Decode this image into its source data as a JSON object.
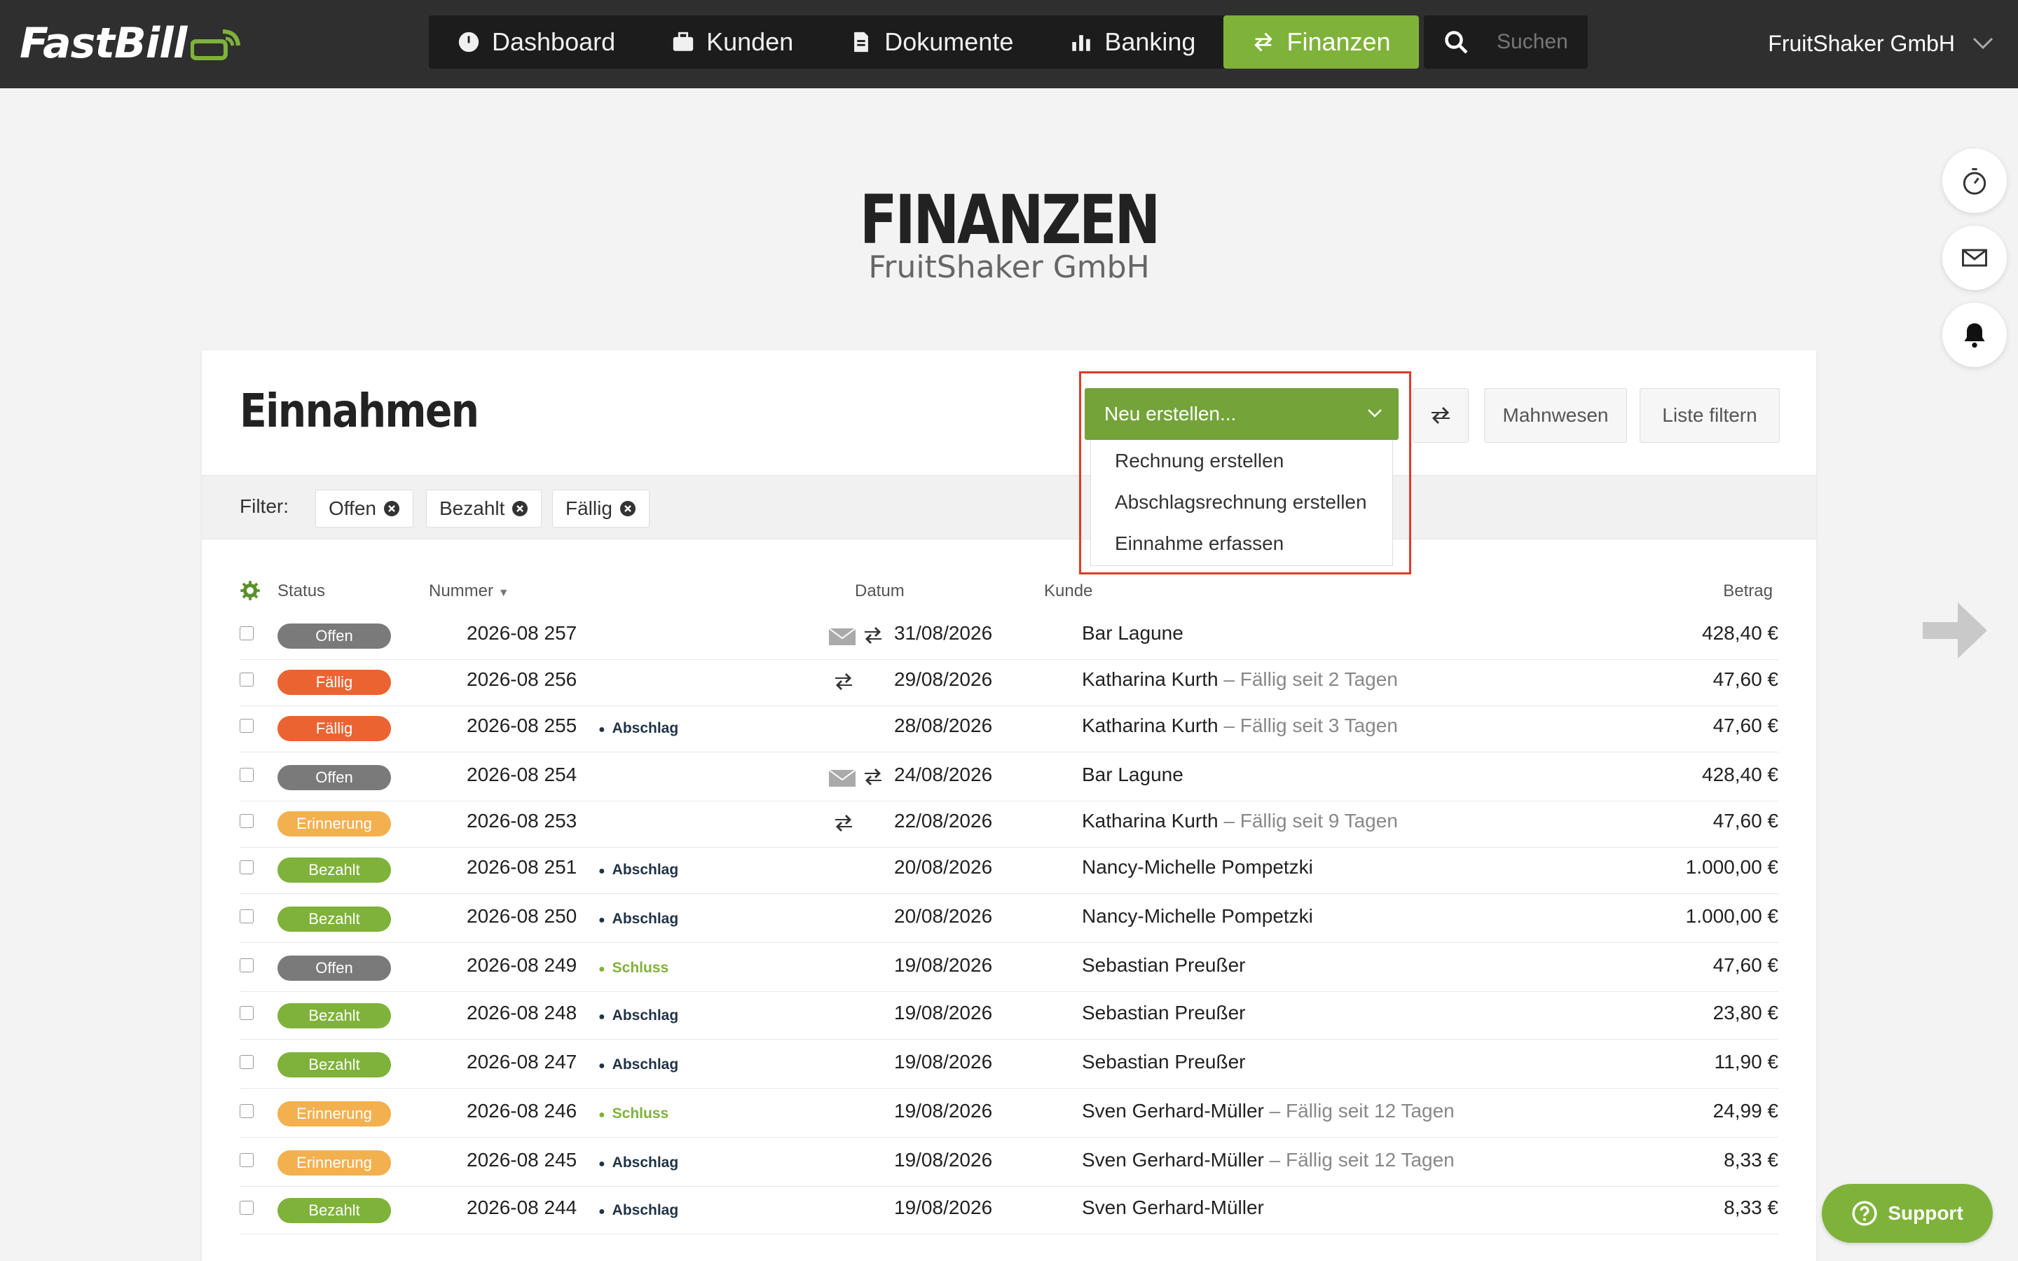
{
  "app": {
    "logo_text": "FastBill"
  },
  "nav": {
    "items": [
      {
        "label": "Dashboard",
        "icon": "dashboard-icon"
      },
      {
        "label": "Kunden",
        "icon": "briefcase-icon"
      },
      {
        "label": "Dokumente",
        "icon": "document-icon"
      },
      {
        "label": "Banking",
        "icon": "bar-chart-icon"
      },
      {
        "label": "Finanzen",
        "icon": "transfer-arrows-icon",
        "active": true
      }
    ],
    "search_placeholder": "Suchen",
    "company": "FruitShaker GmbH"
  },
  "header": {
    "title": "FINANZEN",
    "subtitle": "FruitShaker GmbH"
  },
  "card": {
    "title": "Einnahmen",
    "new_button": "Neu erstellen...",
    "dropdown": [
      "Rechnung erstellen",
      "Abschlagsrechnung erstellen",
      "Einnahme erfassen"
    ],
    "dunning_button": "Mahnwesen",
    "filter_button": "Liste filtern",
    "filter_label": "Filter:",
    "filters": [
      "Offen",
      "Bezahlt",
      "Fällig"
    ]
  },
  "table": {
    "columns": {
      "status": "Status",
      "number": "Nummer",
      "date": "Datum",
      "customer": "Kunde",
      "amount": "Betrag"
    },
    "rows": [
      {
        "status": "Offen",
        "number": "2026-08 257",
        "tag": "",
        "mail": true,
        "repeat": true,
        "date": "31/08/2026",
        "customer": "Bar Lagune",
        "due": "",
        "amount": "428,40 €"
      },
      {
        "status": "Fällig",
        "number": "2026-08 256",
        "tag": "",
        "mail": false,
        "repeat": true,
        "date": "29/08/2026",
        "customer": "Katharina Kurth",
        "due": " – Fällig seit 2 Tagen",
        "amount": "47,60 €"
      },
      {
        "status": "Fällig",
        "number": "2026-08 255",
        "tag": "Abschlag",
        "mail": false,
        "repeat": false,
        "date": "28/08/2026",
        "customer": "Katharina Kurth",
        "due": " – Fällig seit 3 Tagen",
        "amount": "47,60 €"
      },
      {
        "status": "Offen",
        "number": "2026-08 254",
        "tag": "",
        "mail": true,
        "repeat": true,
        "date": "24/08/2026",
        "customer": "Bar Lagune",
        "due": "",
        "amount": "428,40 €"
      },
      {
        "status": "Erinnerung",
        "number": "2026-08 253",
        "tag": "",
        "mail": false,
        "repeat": true,
        "date": "22/08/2026",
        "customer": "Katharina Kurth",
        "due": " – Fällig seit 9 Tagen",
        "amount": "47,60 €"
      },
      {
        "status": "Bezahlt",
        "number": "2026-08 251",
        "tag": "Abschlag",
        "mail": false,
        "repeat": false,
        "date": "20/08/2026",
        "customer": "Nancy-Michelle Pompetzki",
        "due": "",
        "amount": "1.000,00 €"
      },
      {
        "status": "Bezahlt",
        "number": "2026-08 250",
        "tag": "Abschlag",
        "mail": false,
        "repeat": false,
        "date": "20/08/2026",
        "customer": "Nancy-Michelle Pompetzki",
        "due": "",
        "amount": "1.000,00 €"
      },
      {
        "status": "Offen",
        "number": "2026-08 249",
        "tag": "Schluss",
        "mail": false,
        "repeat": false,
        "date": "19/08/2026",
        "customer": "Sebastian Preußer",
        "due": "",
        "amount": "47,60 €"
      },
      {
        "status": "Bezahlt",
        "number": "2026-08 248",
        "tag": "Abschlag",
        "mail": false,
        "repeat": false,
        "date": "19/08/2026",
        "customer": "Sebastian Preußer",
        "due": "",
        "amount": "23,80 €"
      },
      {
        "status": "Bezahlt",
        "number": "2026-08 247",
        "tag": "Abschlag",
        "mail": false,
        "repeat": false,
        "date": "19/08/2026",
        "customer": "Sebastian Preußer",
        "due": "",
        "amount": "11,90 €"
      },
      {
        "status": "Erinnerung",
        "number": "2026-08 246",
        "tag": "Schluss",
        "mail": false,
        "repeat": false,
        "date": "19/08/2026",
        "customer": "Sven Gerhard-Müller",
        "due": " – Fällig seit 12 Tagen",
        "amount": "24,99 €"
      },
      {
        "status": "Erinnerung",
        "number": "2026-08 245",
        "tag": "Abschlag",
        "mail": false,
        "repeat": false,
        "date": "19/08/2026",
        "customer": "Sven Gerhard-Müller",
        "due": " – Fällig seit 12 Tagen",
        "amount": "8,33 €"
      },
      {
        "status": "Bezahlt",
        "number": "2026-08 244",
        "tag": "Abschlag",
        "mail": false,
        "repeat": false,
        "date": "19/08/2026",
        "customer": "Sven Gerhard-Müller",
        "due": "",
        "amount": "8,33 €"
      }
    ]
  },
  "support_label": "Support",
  "colors": {
    "offen": "#7a7a7a",
    "faellig": "#ec6332",
    "erinnerung": "#f2b04f",
    "bezahlt": "#7fb23a",
    "abschlag": "#1f3346",
    "schluss": "#7fb23a",
    "accent": "#7fb23a",
    "highlight": "#e03a2a"
  }
}
